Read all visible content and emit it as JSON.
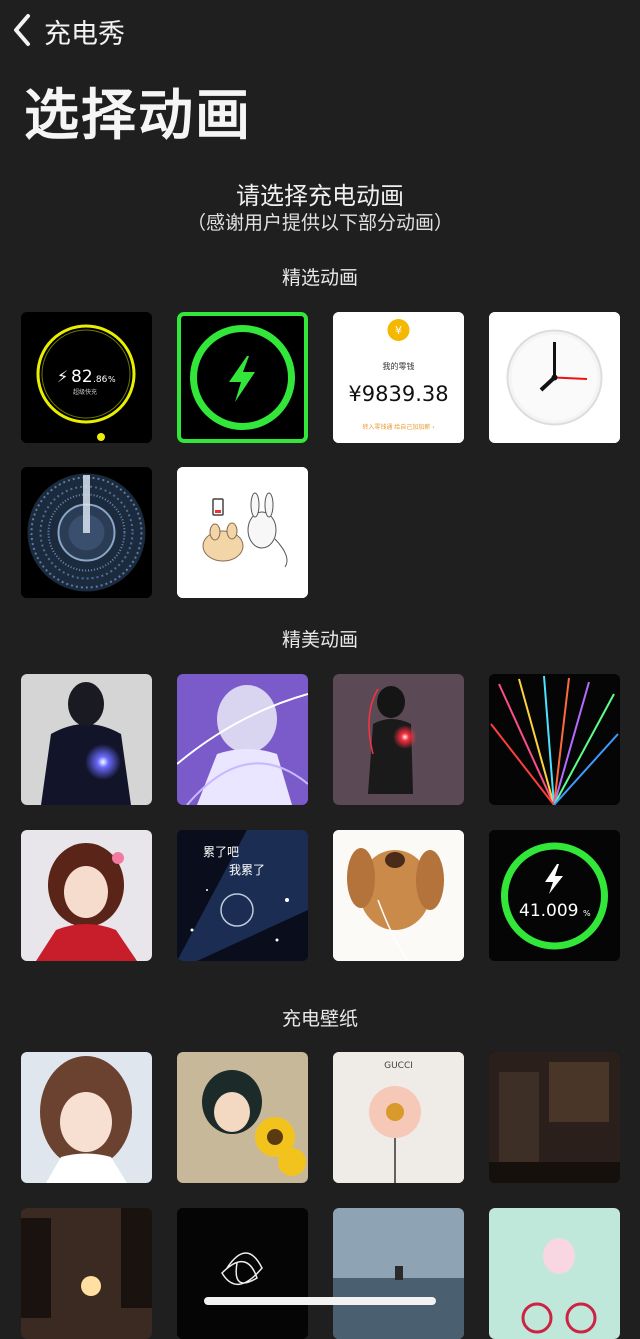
{
  "nav": {
    "back_icon": "chevron-left-icon",
    "title": "充电秀"
  },
  "page_title": "选择动画",
  "prompt": {
    "main": "请选择充电动画",
    "sub": "（感谢用户提供以下部分动画）"
  },
  "sections": [
    {
      "label": "精选动画"
    },
    {
      "label": "精美动画"
    },
    {
      "label": "充电壁纸"
    }
  ],
  "featured": {
    "ring_value": "82",
    "ring_decimal": ".86",
    "ring_unit": "%",
    "ring_caption": "超级快充",
    "wallet_icon": "yen-coin-icon",
    "wallet_symbol": "¥",
    "wallet_title": "我的零钱",
    "wallet_amount": "¥9839.38",
    "wallet_link": "转入零钱通 给自己加加薪 ›"
  },
  "beauty": {
    "ring_value": "41.009",
    "ring_unit": "%",
    "caption1": "累了吧",
    "caption2": "我累了"
  },
  "wallpapers": {
    "brand": "GUCCI"
  },
  "accent": "#33e63a"
}
